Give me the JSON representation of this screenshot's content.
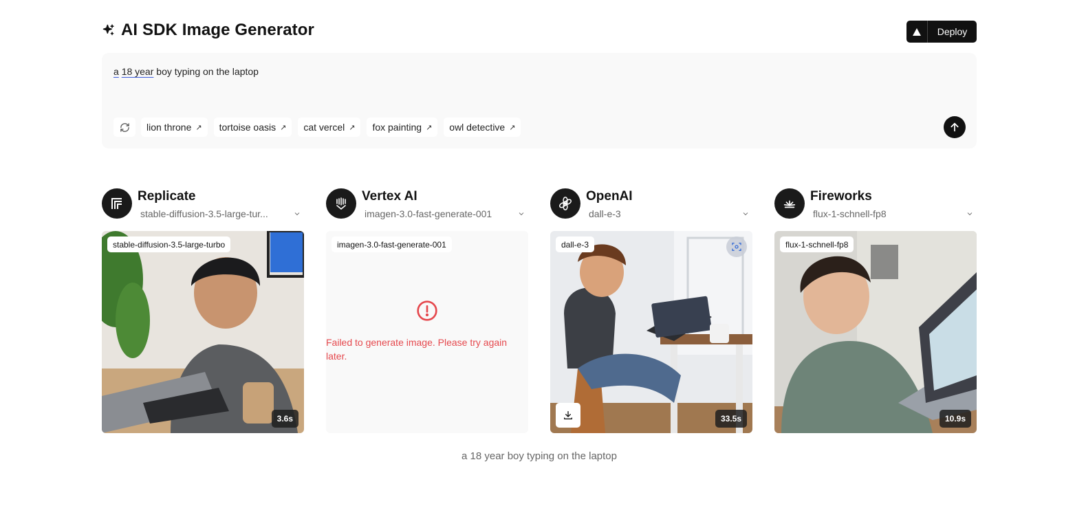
{
  "header": {
    "title": "AI SDK Image Generator",
    "deploy_label": "Deploy"
  },
  "prompt": {
    "word_a": "a",
    "word_18year": "18 year",
    "rest": "boy typing on the laptop",
    "suggestions": [
      "lion throne",
      "tortoise oasis",
      "cat vercel",
      "fox painting",
      "owl detective"
    ]
  },
  "providers": [
    {
      "name": "Replicate",
      "model": "stable-diffusion-3.5-large-tur...",
      "tag": "stable-diffusion-3.5-large-turbo",
      "time": "3.6s",
      "status": "success"
    },
    {
      "name": "Vertex AI",
      "model": "imagen-3.0-fast-generate-001",
      "tag": "imagen-3.0-fast-generate-001",
      "error": "Failed to generate image. Please try again later.",
      "status": "error"
    },
    {
      "name": "OpenAI",
      "model": "dall-e-3",
      "tag": "dall-e-3",
      "time": "33.5s",
      "status": "success"
    },
    {
      "name": "Fireworks",
      "model": "flux-1-schnell-fp8",
      "tag": "flux-1-schnell-fp8",
      "time": "10.9s",
      "status": "success"
    }
  ],
  "caption": "a 18 year boy typing on the laptop",
  "colors": {
    "accent": "#111111",
    "error": "#e5484d",
    "underline": "#3b5bdb"
  }
}
